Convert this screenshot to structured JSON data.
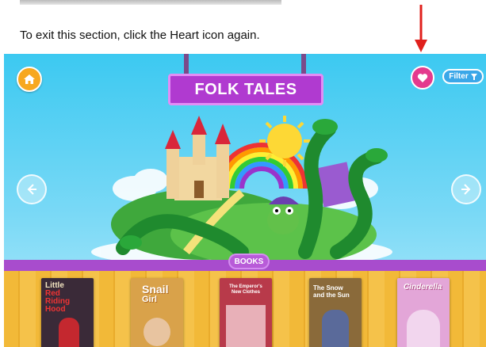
{
  "instruction": "To exit this section, click the Heart icon again.",
  "header": {
    "title": "FOLK TALES",
    "filter_label": "Filter"
  },
  "shelf": {
    "tab_label": "BOOKS",
    "books": [
      {
        "title_lines": [
          "Little",
          "Red",
          "Riding",
          "Hood"
        ],
        "cover": "#3a2a38"
      },
      {
        "title_lines": [
          "Snail",
          "Girl"
        ],
        "cover": "#d9a24a"
      },
      {
        "title_lines": [
          "The Emperor's",
          "New Clothes"
        ],
        "cover": "#b83a4a"
      },
      {
        "title_lines": [
          "The Snow",
          "and the Sun"
        ],
        "cover": "#8a6a3a"
      },
      {
        "title_lines": [
          "Cinderella"
        ],
        "cover": "#e3a6d8"
      }
    ]
  },
  "colors": {
    "sky": "#3cc9f1",
    "accent_purple": "#b03ad0",
    "heart": "#e43a8e",
    "home": "#f7a81f",
    "filter": "#3aa7e8",
    "arrow": "#e0201c"
  }
}
